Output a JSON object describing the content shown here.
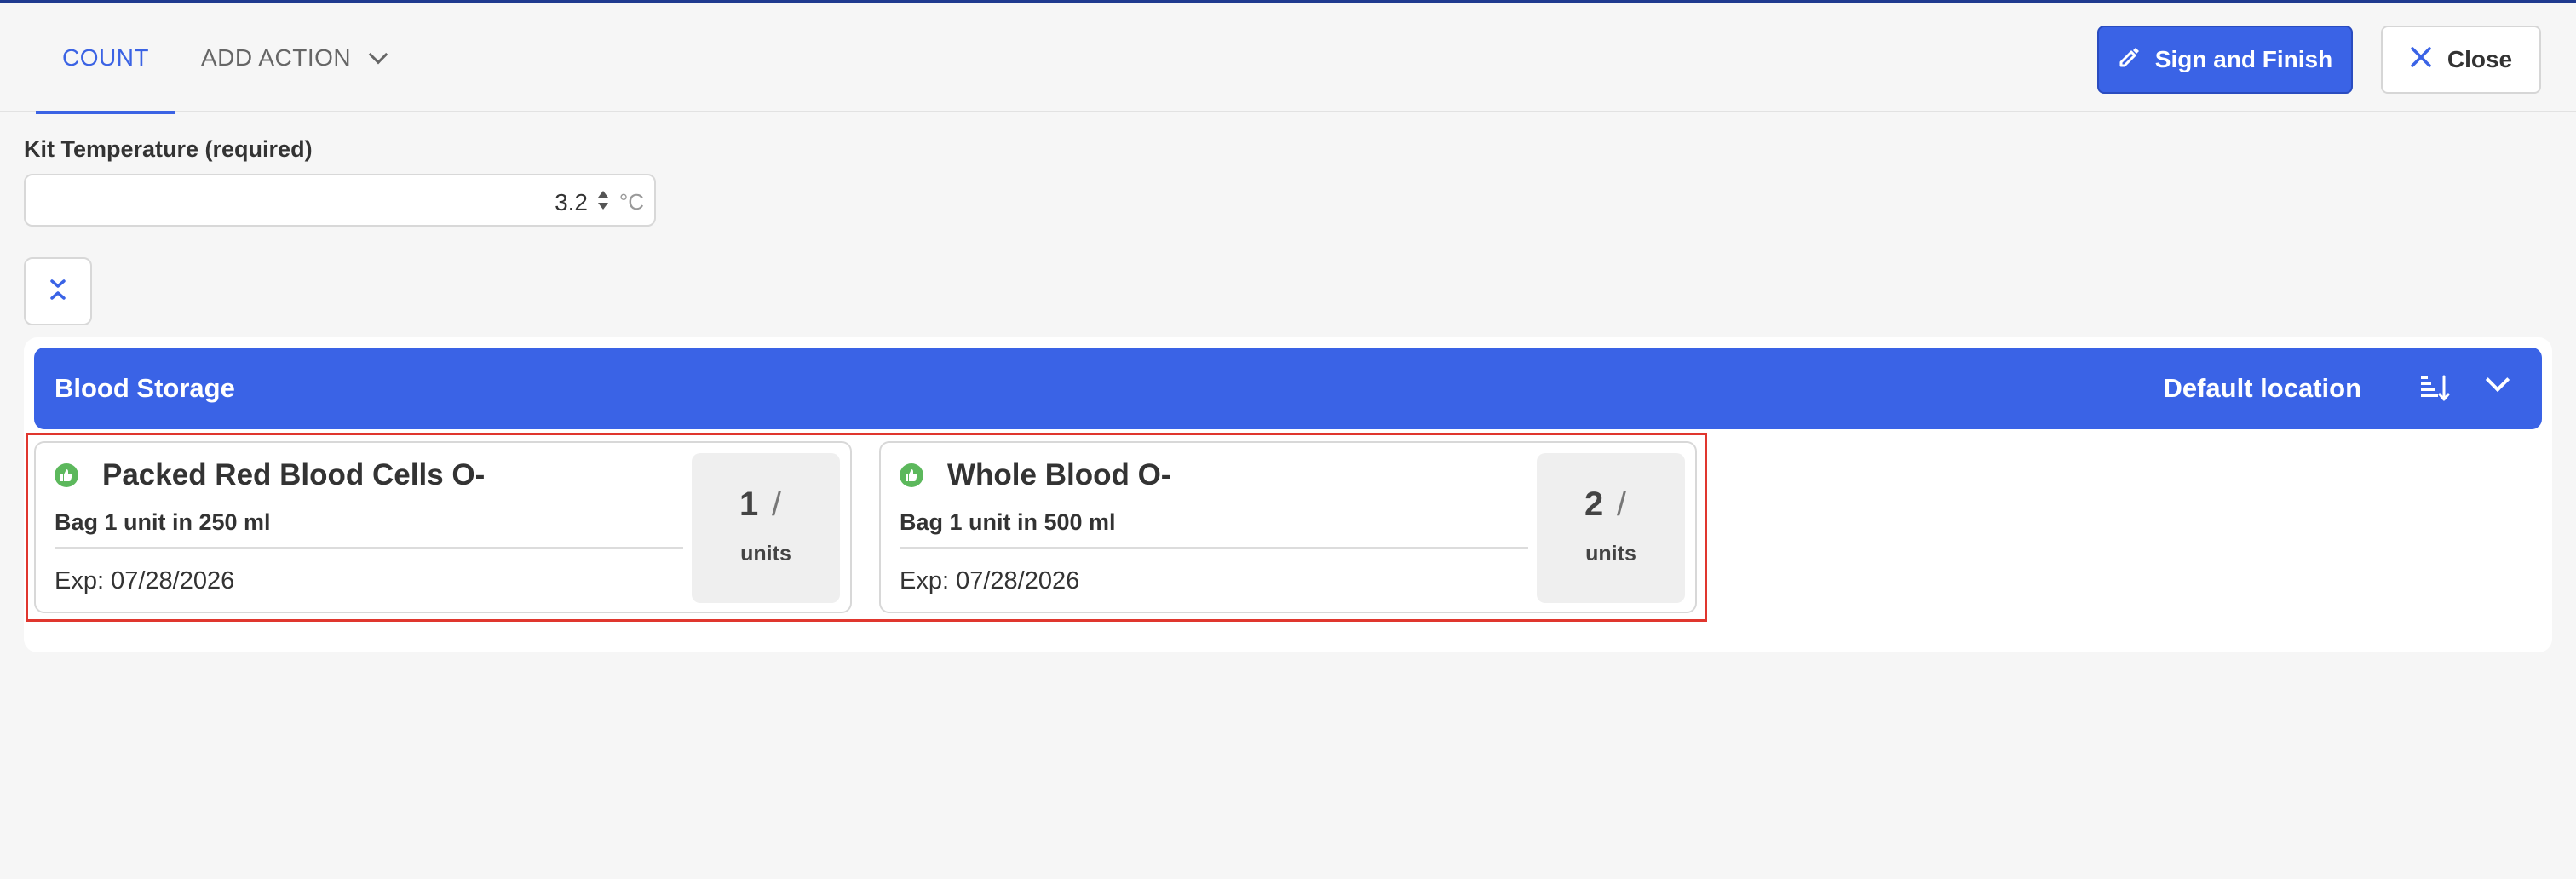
{
  "header": {
    "tabs": [
      {
        "label": "COUNT",
        "active": true
      },
      {
        "label": "ADD ACTION",
        "active": false
      }
    ],
    "sign_button": "Sign and Finish",
    "close_button": "Close"
  },
  "kit_temperature": {
    "label": "Kit Temperature (required)",
    "value": "3.2",
    "unit": "°C"
  },
  "storage": {
    "title": "Blood Storage",
    "location": "Default location"
  },
  "cards": [
    {
      "name": "Packed Red Blood Cells O-",
      "description": "Bag 1 unit in 250 ml",
      "expiry": "Exp: 07/28/2026",
      "count": "1",
      "slash": "/",
      "unit": "units",
      "status_icon": "thumbs-up-icon"
    },
    {
      "name": "Whole Blood O-",
      "description": "Bag 1 unit in 500 ml",
      "expiry": "Exp: 07/28/2026",
      "count": "2",
      "slash": "/",
      "unit": "units",
      "status_icon": "thumbs-up-icon"
    }
  ],
  "colors": {
    "accent": "#3a63e6",
    "status_ok": "#5cb85c",
    "highlight": "#e0362e"
  }
}
